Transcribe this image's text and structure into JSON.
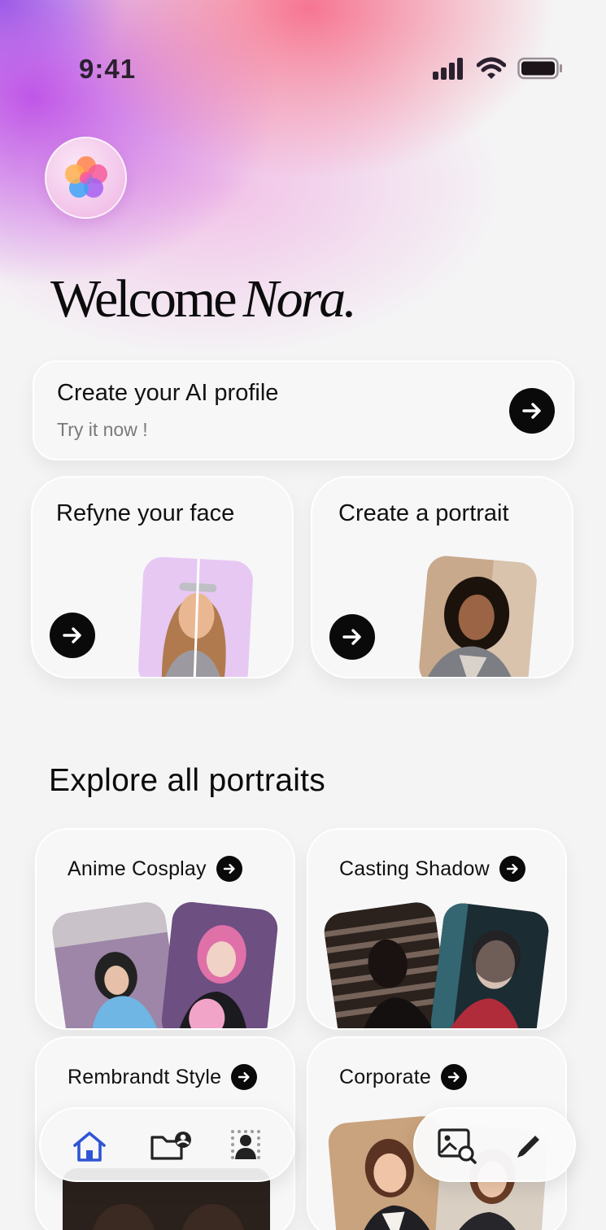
{
  "status_bar": {
    "time": "9:41",
    "icons": [
      "signal-icon",
      "wifi-icon",
      "battery-icon"
    ]
  },
  "app": {
    "logo_icon": "flower-logo-icon"
  },
  "header": {
    "welcome": "Welcome",
    "name": "Nora."
  },
  "ai_profile_card": {
    "title": "Create your AI profile",
    "subtitle": "Try it now !"
  },
  "feature_cards": [
    {
      "title": "Refyne your face"
    },
    {
      "title": "Create a portrait"
    }
  ],
  "explore": {
    "title": "Explore all portraits",
    "categories": [
      {
        "label": "Anime Cosplay"
      },
      {
        "label": "Casting Shadow"
      },
      {
        "label": "Rembrandt Style"
      },
      {
        "label": "Corporate"
      }
    ]
  },
  "bottom_nav": {
    "left_items": [
      "home-icon",
      "profile-folder-icon",
      "portrait-grid-icon"
    ],
    "right_items": [
      "image-search-icon",
      "pencil-icon"
    ],
    "active": "home-icon",
    "active_color": "#2f55d4"
  },
  "colors": {
    "accent_dark": "#0a0a0a",
    "background": "#f4f4f5",
    "gradient_pink": "#f66e8c",
    "gradient_purple": "#ba46e6"
  }
}
